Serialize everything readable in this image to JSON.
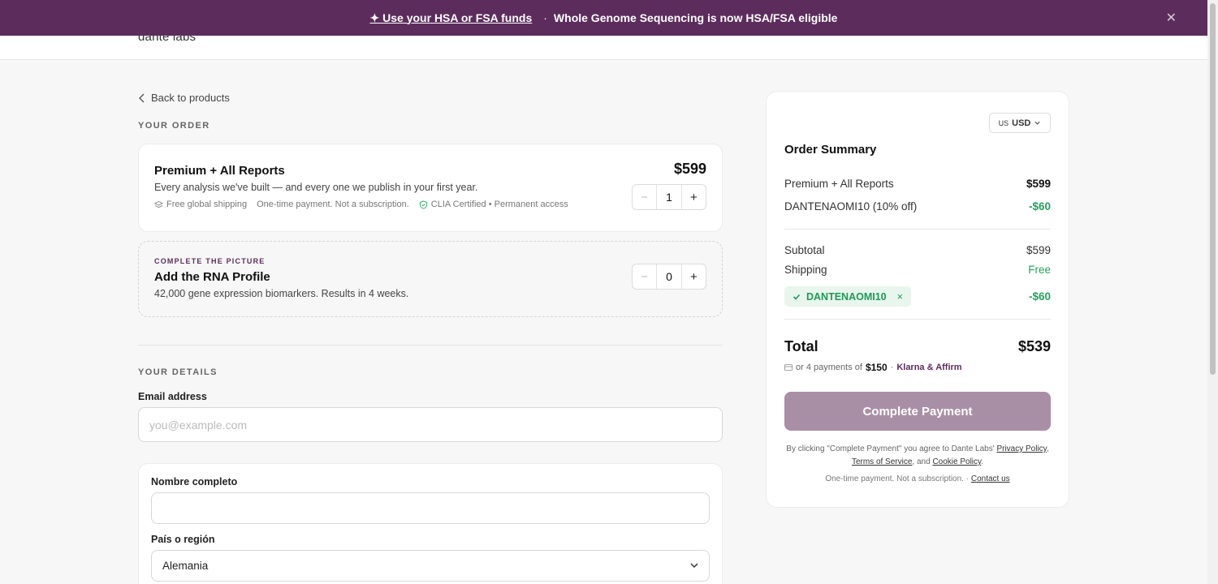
{
  "banner": {
    "highlight": "✦ Use your HSA or FSA funds",
    "separator": "·",
    "message": "Whole Genome Sequencing is now HSA/FSA eligible",
    "close_icon": "close-icon"
  },
  "header": {
    "logo": "dante labs"
  },
  "back_link": "Back to products",
  "order": {
    "label": "YOUR ORDER",
    "product": {
      "title": "Premium + All Reports",
      "description": "Every analysis we've built — and every one we publish in your first year.",
      "meta_shipping": "Free global shipping",
      "meta_payment": "One-time payment. Not a subscription.",
      "meta_clia": "CLIA Certified • Permanent access",
      "price": "$599",
      "quantity": "1"
    },
    "upsell": {
      "kicker": "COMPLETE THE PICTURE",
      "title": "Add the RNA Profile",
      "description": "42,000 gene expression biomarkers. Results in 4 weeks.",
      "quantity": "0"
    },
    "minus": "−",
    "plus": "+"
  },
  "details": {
    "label": "YOUR DETAILS",
    "email_label": "Email address",
    "email_placeholder": "you@example.com",
    "name_label": "Nombre completo",
    "name_value": "",
    "country_label": "País o región",
    "country_value": "Alemania"
  },
  "summary": {
    "currency_flag": "US",
    "currency": "USD",
    "title": "Order Summary",
    "line_item_label": "Premium + All Reports",
    "line_item_value": "$599",
    "discount_label": "DANTENAOMI10 (10% off)",
    "discount_value": "-$60",
    "subtotal_label": "Subtotal",
    "subtotal_value": "$599",
    "shipping_label": "Shipping",
    "shipping_value": "Free",
    "coupon_code": "DANTENAOMI10",
    "coupon_remove": "×",
    "coupon_value": "-$60",
    "total_label": "Total",
    "total_value": "$539",
    "installments_prefix": "or 4 payments of",
    "installments_amount": "$150",
    "installments_dot": "·",
    "installments_provider": "Klarna & Affirm",
    "pay_button": "Complete Payment",
    "legal_prefix": "By clicking \"Complete Payment\" you agree to Dante Labs'",
    "privacy_link": "Privacy Policy",
    "terms_link": "Terms of Service",
    "legal_and": ", and",
    "cookie_link": "Cookie Policy",
    "note_text": "One-time payment. Not a subscription. ·",
    "contact_link": "Contact us"
  },
  "colors": {
    "brand": "#5c2d5c",
    "button": "#a98fa6",
    "success": "#22a45d"
  }
}
